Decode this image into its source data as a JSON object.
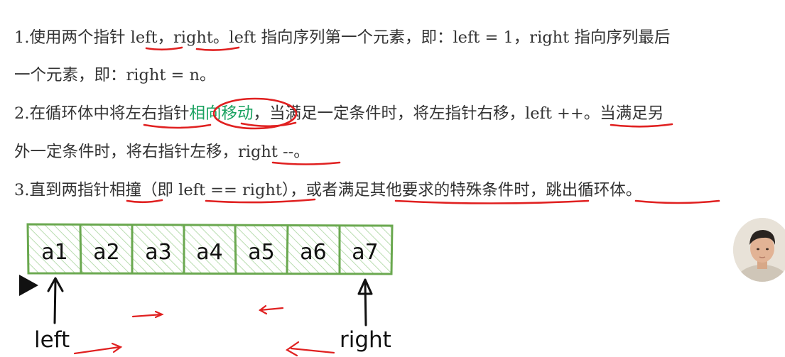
{
  "text": {
    "l1": {
      "a": "1.使用两个指针 ",
      "b": "left",
      "c": "，",
      "d": "right",
      "e": "。left 指向序列第一个元素，即：left = 1，right 指向序列最后"
    },
    "l2": "一个元素，即：right = n。",
    "l3": {
      "a": "2.在循环体中将",
      "b": "左右指针",
      "c": "相向移动",
      "d": "，当满足一定条件时，将左指针右移，",
      "e": "left ++",
      "f": "。当满足另"
    },
    "l4": {
      "a": "外一定条件时，将右指针左移，",
      "b": "right --",
      "c": "。"
    },
    "l5": {
      "a": "3.直到两指针",
      "b": "相撞",
      "c": "（即 ",
      "d": "left == right",
      "e": "），或者",
      "f": "满足其他要求的特殊条件",
      "g": "时，",
      "h": "跳出循环体",
      "i": "。"
    }
  },
  "array": {
    "cells": [
      "a1",
      "a2",
      "a3",
      "a4",
      "a5",
      "a6",
      "a7"
    ],
    "left_label": "left",
    "right_label": "right"
  },
  "colors": {
    "text": "#333333",
    "highlight_green": "#1aa260",
    "annotation_red": "#e02020",
    "cell_border": "#6aa84f",
    "cell_hatch": "#b9ddb0"
  },
  "icons": {
    "play": "play-icon",
    "avatar": "presenter-avatar"
  }
}
